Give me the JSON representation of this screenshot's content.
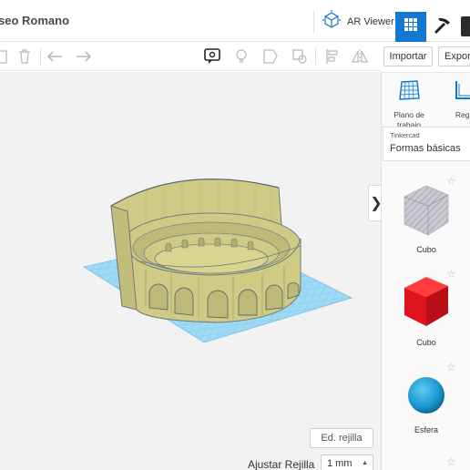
{
  "header": {
    "title": "seo Romano",
    "ar_viewer_label": "AR Viewer"
  },
  "actions": {
    "import_label": "Importar",
    "export_label": "Export"
  },
  "workplane": {
    "edit_grid_label": "Ed. rejilla",
    "snap_grid_label": "Ajustar Rejilla",
    "snap_grid_value": "1 mm"
  },
  "helpers": [
    {
      "label": "Plano de trabajo",
      "icon": "workplane-icon"
    },
    {
      "label": "Regla",
      "icon": "ruler-icon"
    }
  ],
  "library": {
    "source": "Tinkercad",
    "category": "Formas básicas"
  },
  "shapes": [
    {
      "label": "Cubo",
      "color": "#c8c8d0",
      "style": "hole"
    },
    {
      "label": "Cubo",
      "color": "#e0141e",
      "style": "solid"
    },
    {
      "label": "Esfera",
      "color": "#1ea1d7",
      "style": "solid"
    }
  ],
  "colors": {
    "accent": "#1477d1",
    "model": "#d4d08a",
    "grid": "#8fd3f3"
  }
}
